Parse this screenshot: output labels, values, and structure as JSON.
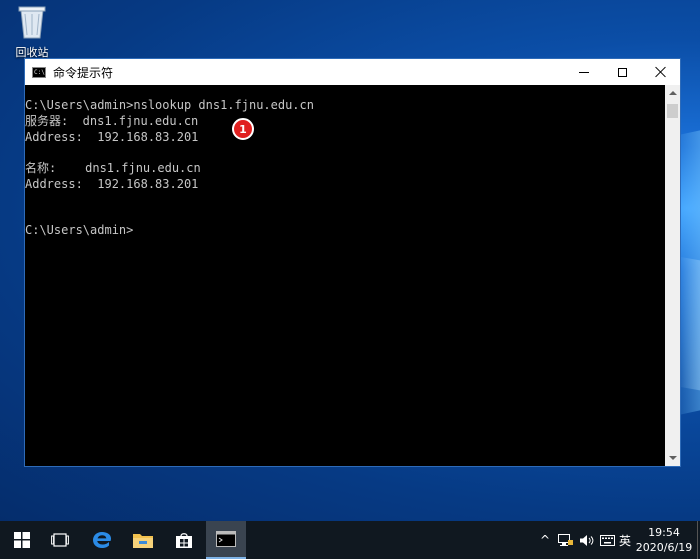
{
  "desktop": {
    "recycle_bin_label": "回收站"
  },
  "window": {
    "title": "命令提示符",
    "console_lines": [
      "C:\\Users\\admin>nslookup dns1.fjnu.edu.cn",
      "服务器:  dns1.fjnu.edu.cn",
      "Address:  192.168.83.201",
      "",
      "名称:    dns1.fjnu.edu.cn",
      "Address:  192.168.83.201",
      "",
      "",
      "C:\\Users\\admin>"
    ],
    "annotation_badge": "1"
  },
  "taskbar": {
    "tray_chevron": "^",
    "ime_label": "英",
    "clock_time": "19:54",
    "clock_date": "2020/6/19"
  },
  "colors": {
    "console_bg": "#000000",
    "console_text": "#c6c6c6",
    "badge": "#e02020",
    "taskbar": "#101820"
  }
}
